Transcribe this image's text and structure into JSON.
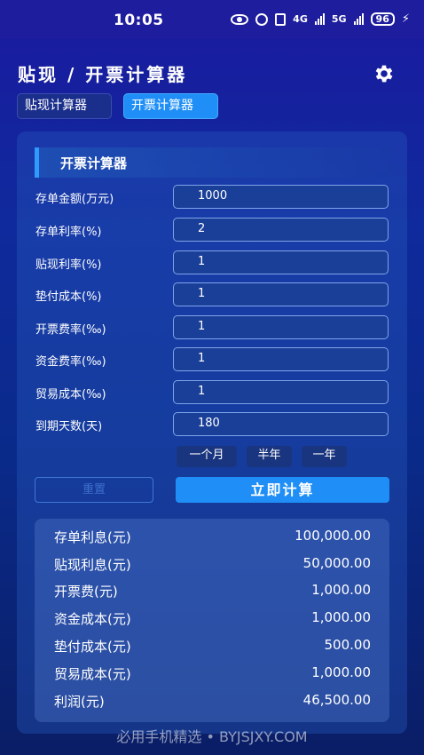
{
  "status_bar": {
    "time": "10:05",
    "network_1": "4G",
    "network_2": "5G",
    "battery": "96"
  },
  "header": {
    "title": "贴现 / 开票计算器"
  },
  "tabs": [
    {
      "label": "贴现计算器",
      "active": false
    },
    {
      "label": "开票计算器",
      "active": true
    }
  ],
  "form": {
    "section_title": "开票计算器",
    "fields": [
      {
        "label": "存单金额(万元)",
        "value": "1000"
      },
      {
        "label": "存单利率(%)",
        "value": "2"
      },
      {
        "label": "贴现利率(%)",
        "value": "1"
      },
      {
        "label": "垫付成本(%)",
        "value": "1"
      },
      {
        "label": "开票费率(‰)",
        "value": "1"
      },
      {
        "label": "资金费率(‰)",
        "value": "1"
      },
      {
        "label": "贸易成本(‰)",
        "value": "1"
      },
      {
        "label": "到期天数(天)",
        "value": "180"
      }
    ],
    "quick_options": [
      "一个月",
      "半年",
      "一年"
    ],
    "reset_label": "重置",
    "calculate_label": "立即计算"
  },
  "results": [
    {
      "label": "存单利息(元)",
      "value": "100,000.00"
    },
    {
      "label": "贴现利息(元)",
      "value": "50,000.00"
    },
    {
      "label": "开票费(元)",
      "value": "1,000.00"
    },
    {
      "label": "资金成本(元)",
      "value": "1,000.00"
    },
    {
      "label": "垫付成本(元)",
      "value": "500.00"
    },
    {
      "label": "贸易成本(元)",
      "value": "1,000.00"
    },
    {
      "label": "利润(元)",
      "value": "46,500.00"
    }
  ],
  "watermark": "必用手机精选 • BYJSJXY.COM",
  "colors": {
    "accent": "#1f8ff7",
    "background": "#0f2a9c",
    "status_bar": "#1e1d9e"
  }
}
